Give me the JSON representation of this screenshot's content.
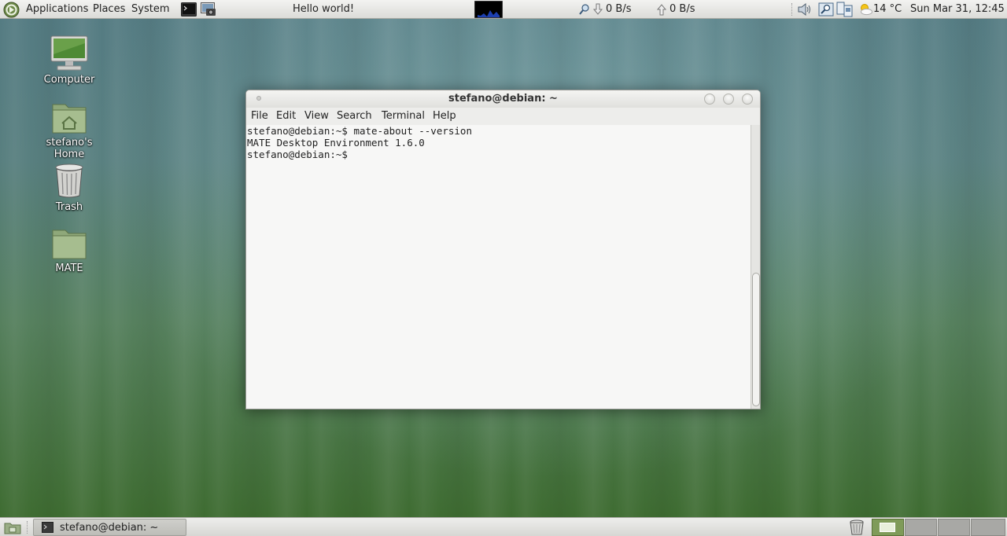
{
  "top_panel": {
    "menu": {
      "applications": "Applications",
      "places": "Places",
      "system": "System"
    },
    "title_text": "Hello world!",
    "net_down": "0 B/s",
    "net_up": "0 B/s",
    "weather": "14 °C",
    "clock": "Sun Mar 31, 12:45"
  },
  "desktop": {
    "icons": [
      {
        "label": "Computer",
        "icon": "computer-icon"
      },
      {
        "label": "stefano's Home",
        "icon": "home-folder-icon"
      },
      {
        "label": "Trash",
        "icon": "trash-icon"
      },
      {
        "label": "MATE",
        "icon": "folder-icon"
      }
    ]
  },
  "window": {
    "title": "stefano@debian: ~",
    "menu": [
      "File",
      "Edit",
      "View",
      "Search",
      "Terminal",
      "Help"
    ],
    "terminal_lines": [
      "stefano@debian:~$ mate-about --version",
      "MATE Desktop Environment 1.6.0",
      "stefano@debian:~$"
    ]
  },
  "bottom_panel": {
    "task_label": "stefano@debian: ~",
    "workspaces": 4,
    "active_workspace": 1
  },
  "colors": {
    "desktop_top": "#547b83",
    "desktop_bottom": "#3c6a2d",
    "panel": "#e8e8e5",
    "terminal_bg": "#f7f7f6"
  }
}
